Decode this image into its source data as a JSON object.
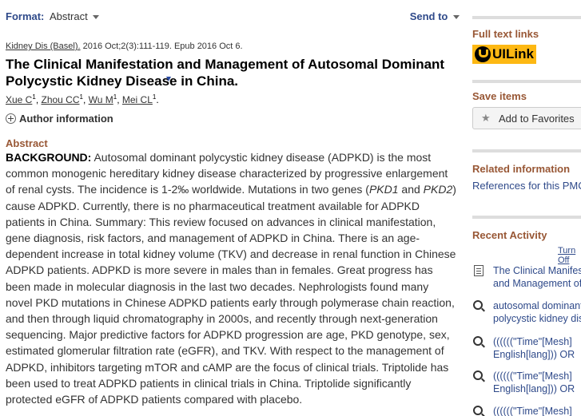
{
  "topbar": {
    "format_label": "Format:",
    "format_value": "Abstract",
    "send_to": "Send to"
  },
  "citation": {
    "journal": "Kidney Dis (Basel).",
    "details": " 2016 Oct;2(3):111-119. Epub 2016 Oct 6."
  },
  "article": {
    "title": "The Clinical Manifestation and Management of Autosomal Dominant Polycystic Kidney Disease in China.",
    "authors": [
      {
        "name": "Xue C",
        "aff": "1"
      },
      {
        "name": "Zhou CC",
        "aff": "1"
      },
      {
        "name": "Wu M",
        "aff": "1"
      },
      {
        "name": "Mei CL",
        "aff": "1"
      }
    ],
    "author_info": "Author information"
  },
  "abstract": {
    "heading": "Abstract",
    "label": "BACKGROUND:",
    "part1": " Autosomal dominant polycystic kidney disease (ADPKD) is the most common monogenic hereditary kidney disease characterized by progressive enlargement of renal cysts. The incidence is 1-2‰ worldwide. Mutations in two genes (",
    "gene1": "PKD1",
    "mid": " and ",
    "gene2": "PKD2",
    "part2": ") cause ADPKD. Currently, there is no pharmaceutical treatment available for ADPKD patients in China. Summary: This review focused on advances in clinical manifestation, gene diagnosis, risk factors, and management of ADPKD in China. There is an age-dependent increase in total kidney volume (TKV) and decrease in renal function in Chinese ADPKD patients. ADPKD is more severe in males than in females. Great progress has been made in molecular diagnosis in the last two decades. Nephrologists found many novel PKD mutations in Chinese ADPKD patients early through polymerase chain reaction, and then through liquid chromatography in 2000s, and recently through next-generation sequencing. Major predictive factors for ADPKD progression are age, PKD genotype, sex, estimated glomerular filtration rate (eGFR), and TKV. With respect to the management of ADPKD, inhibitors targeting mTOR and cAMP are the focus of clinical trials. Triptolide has been used to treat ADPKD patients in clinical trials in China. Triptolide significantly protected eGFR of ADPKD patients compared with placebo."
  },
  "sidebar": {
    "full_text": {
      "heading": "Full text links",
      "uilink": "UILink"
    },
    "save_items": {
      "heading": "Save items",
      "favorites": "Add to Favorites"
    },
    "related": {
      "heading": "Related information",
      "references": "References for this PMC Article"
    },
    "recent": {
      "heading": "Recent Activity",
      "toggle": "Turn Off",
      "items": [
        {
          "icon": "document-icon",
          "line1": "The Clinical Manifestation",
          "line2": "and Management of"
        },
        {
          "icon": "search-icon",
          "line1": "autosomal dominant",
          "line2": "polycystic kidney disease"
        },
        {
          "icon": "search-icon",
          "line1": "((((((\"Time\"[Mesh]",
          "line2": "English[lang])) OR"
        },
        {
          "icon": "search-icon",
          "line1": "((((((\"Time\"[Mesh]",
          "line2": "English[lang])) OR"
        },
        {
          "icon": "search-icon",
          "line1": "((((((\"Time\"[Mesh]",
          "line2": ""
        }
      ]
    }
  },
  "colors": {
    "link": "#2f4a8a",
    "section_heading": "#985735",
    "uilink_bg": "#fdb813"
  }
}
